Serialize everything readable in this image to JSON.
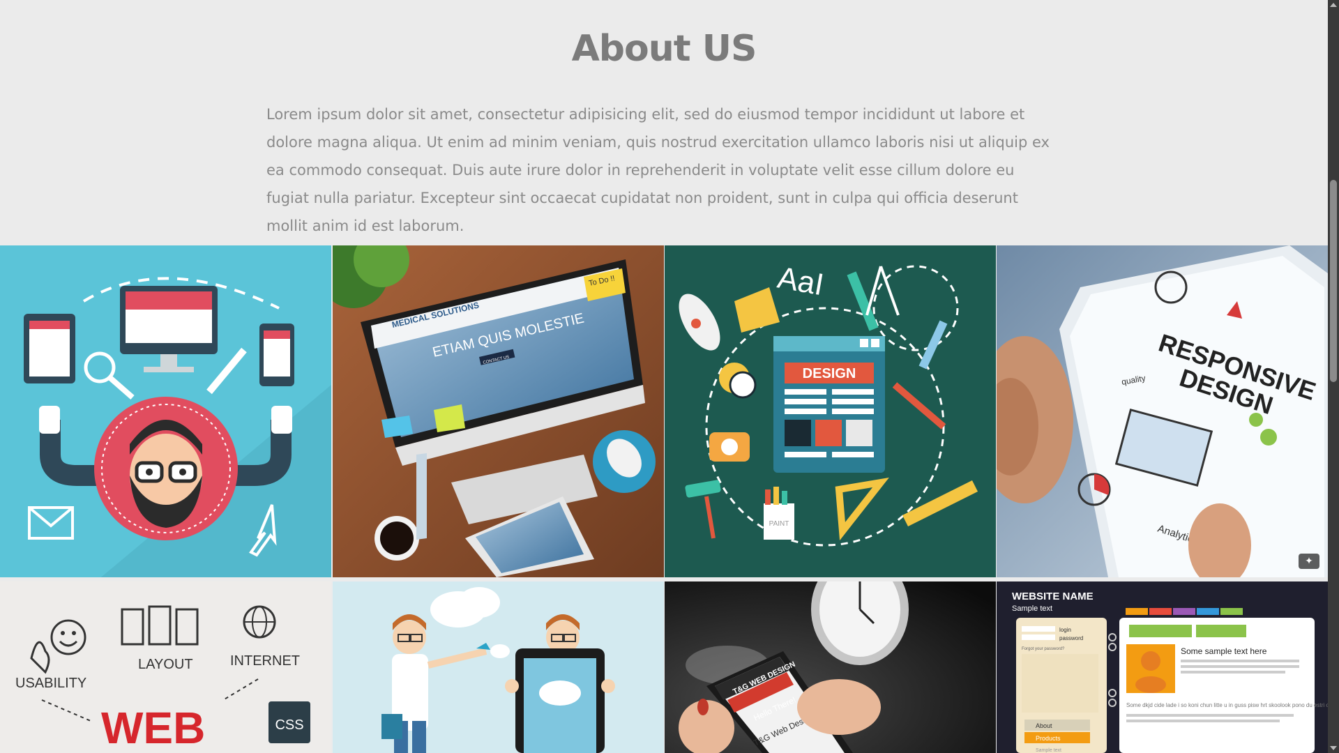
{
  "about": {
    "title": "About US",
    "paragraph": "Lorem ipsum dolor sit amet, consectetur adipisicing elit, sed do eiusmod tempor incididunt ut labore et dolore magna aliqua. Ut enim ad minim veniam, quis nostrud exercitation ullamco laboris nisi ut aliquip ex ea commodo consequat. Duis aute irure dolor in reprehenderit in voluptate velit esse cillum dolore eu fugiat nulla pariatur. Excepteur sint occaecat cupidatat non proident, sunt in culpa qui officia deserunt mollit anim id est laborum."
  },
  "gallery": {
    "tile2": {
      "brand": "MEDICAL SOLUTIONS",
      "headline": "ETIAM QUIS MOLESTIE",
      "button": "CONTACT US",
      "sticky_note": "To Do !!"
    },
    "tile3": {
      "letters": "AaI",
      "window_label": "DESIGN",
      "cup_label": "PAINT"
    },
    "tile4": {
      "line1": "RESPONSIVE",
      "line2": "DESIGN",
      "note_quality": "quality",
      "note_analytics": "Analytics"
    },
    "tile5": {
      "usability": "USABILITY",
      "layout": "LAYOUT",
      "internet": "INTERNET",
      "web": "WEB",
      "css": "CSS"
    },
    "tile7": {
      "brand": "T&G WEB DESIGN",
      "hello": "Hello There!",
      "headline": "T&G Web Design"
    },
    "tile8": {
      "site_name": "WEBSITE NAME",
      "sample": "Sample text",
      "login": "login",
      "password": "password",
      "forgot": "Forgot your password?",
      "heading": "Some sample text here",
      "menu_about": "About",
      "menu_products": "Products",
      "menu_sample": "Sample text",
      "body_text": "Some dkjd cide lade i so koni chun litte u in guss pisw hrt skoolook pono du estri ok shj parableth lotu du katt js j in enterr fagos oink ss yuy ikuh olk yyjl idppkah pa fuss 'je like that."
    }
  },
  "colors": {
    "background": "#ebebeb",
    "title": "#7b7b7b",
    "text": "#8a8a8a",
    "tile1_bg": "#5bc4d8",
    "tile3_bg": "#1d5a50",
    "accent_red": "#e14d5f"
  },
  "icons": [
    "magic-wand-icon"
  ]
}
